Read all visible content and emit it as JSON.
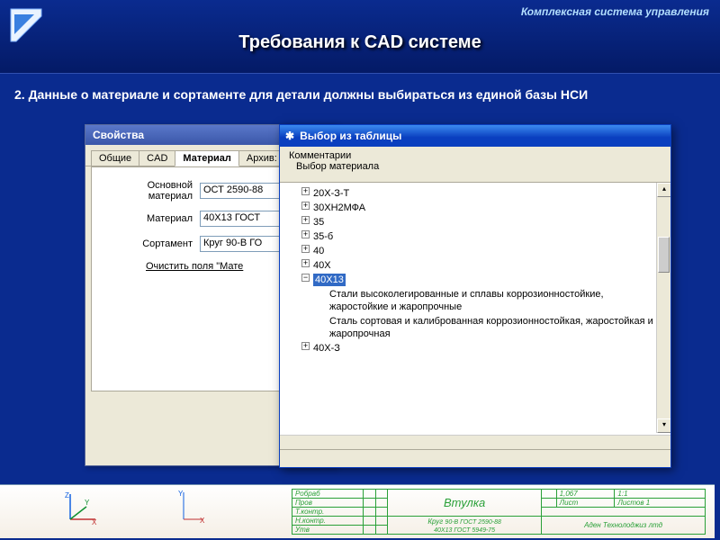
{
  "header": {
    "subtitle": "Комплексная система управления",
    "title": "Требования к CAD системе"
  },
  "body_text": "2. Данные о материале и сортаменте для детали должны выбираться из единой базы НСИ",
  "properties_window": {
    "title": "Свойства",
    "tabs": [
      "Общие",
      "CAD",
      "Материал",
      "Архив: $V"
    ],
    "active_tab": 2,
    "fields": {
      "osn_material_label": "Основной материал",
      "osn_material_value": "ОСТ 2590-88",
      "material_label": "Материал",
      "material_value": "40Х13 ГОСТ",
      "sortament_label": "Сортамент",
      "sortament_value": "Круг 90-В ГО"
    },
    "clear_link": "Очистить поля \"Мате"
  },
  "picker_window": {
    "title": "Выбор из таблицы",
    "menu": {
      "comments": "Комментарии",
      "vybor": "Выбор материала"
    },
    "tree": {
      "items": [
        {
          "label": "20Х-З-Т",
          "expand": "+",
          "depth": 1
        },
        {
          "label": "30ХН2МФА",
          "expand": "+",
          "depth": 1
        },
        {
          "label": "35",
          "expand": "+",
          "depth": 1
        },
        {
          "label": "35-б",
          "expand": "+",
          "depth": 1
        },
        {
          "label": "40",
          "expand": "+",
          "depth": 1
        },
        {
          "label": "40Х",
          "expand": "+",
          "depth": 1
        },
        {
          "label": "40Х13",
          "expand": "−",
          "depth": 1,
          "selected": true
        },
        {
          "label": "Стали высоколегированные и сплавы коррозионностойкие, жаростойкие и жаропрочные",
          "depth": 2,
          "child": true
        },
        {
          "label": "Сталь сортовая и калиброванная коррозионностойкая, жаростойкая и жаропрочная",
          "depth": 2,
          "child": true
        },
        {
          "label": "40Х-З",
          "expand": "+",
          "depth": 1
        }
      ]
    }
  },
  "cad_strip": {
    "axes": {
      "x": "X",
      "y": "Y",
      "z": "Z"
    },
    "col1": [
      "Робраб",
      "Пров",
      "Т.контр.",
      "Н.контр.",
      "Утв"
    ],
    "part": "Втулка",
    "ratio1": "1,067",
    "ratio2": "1:1",
    "name": "Аден Технолоджиз лтд",
    "mat1": "90-В ГОСТ 2590-88",
    "mat2": "40Х13 ГОСТ 5949-75",
    "mat_label": "Круг",
    "ext1": "Лист",
    "ext2": "Листов 1"
  }
}
